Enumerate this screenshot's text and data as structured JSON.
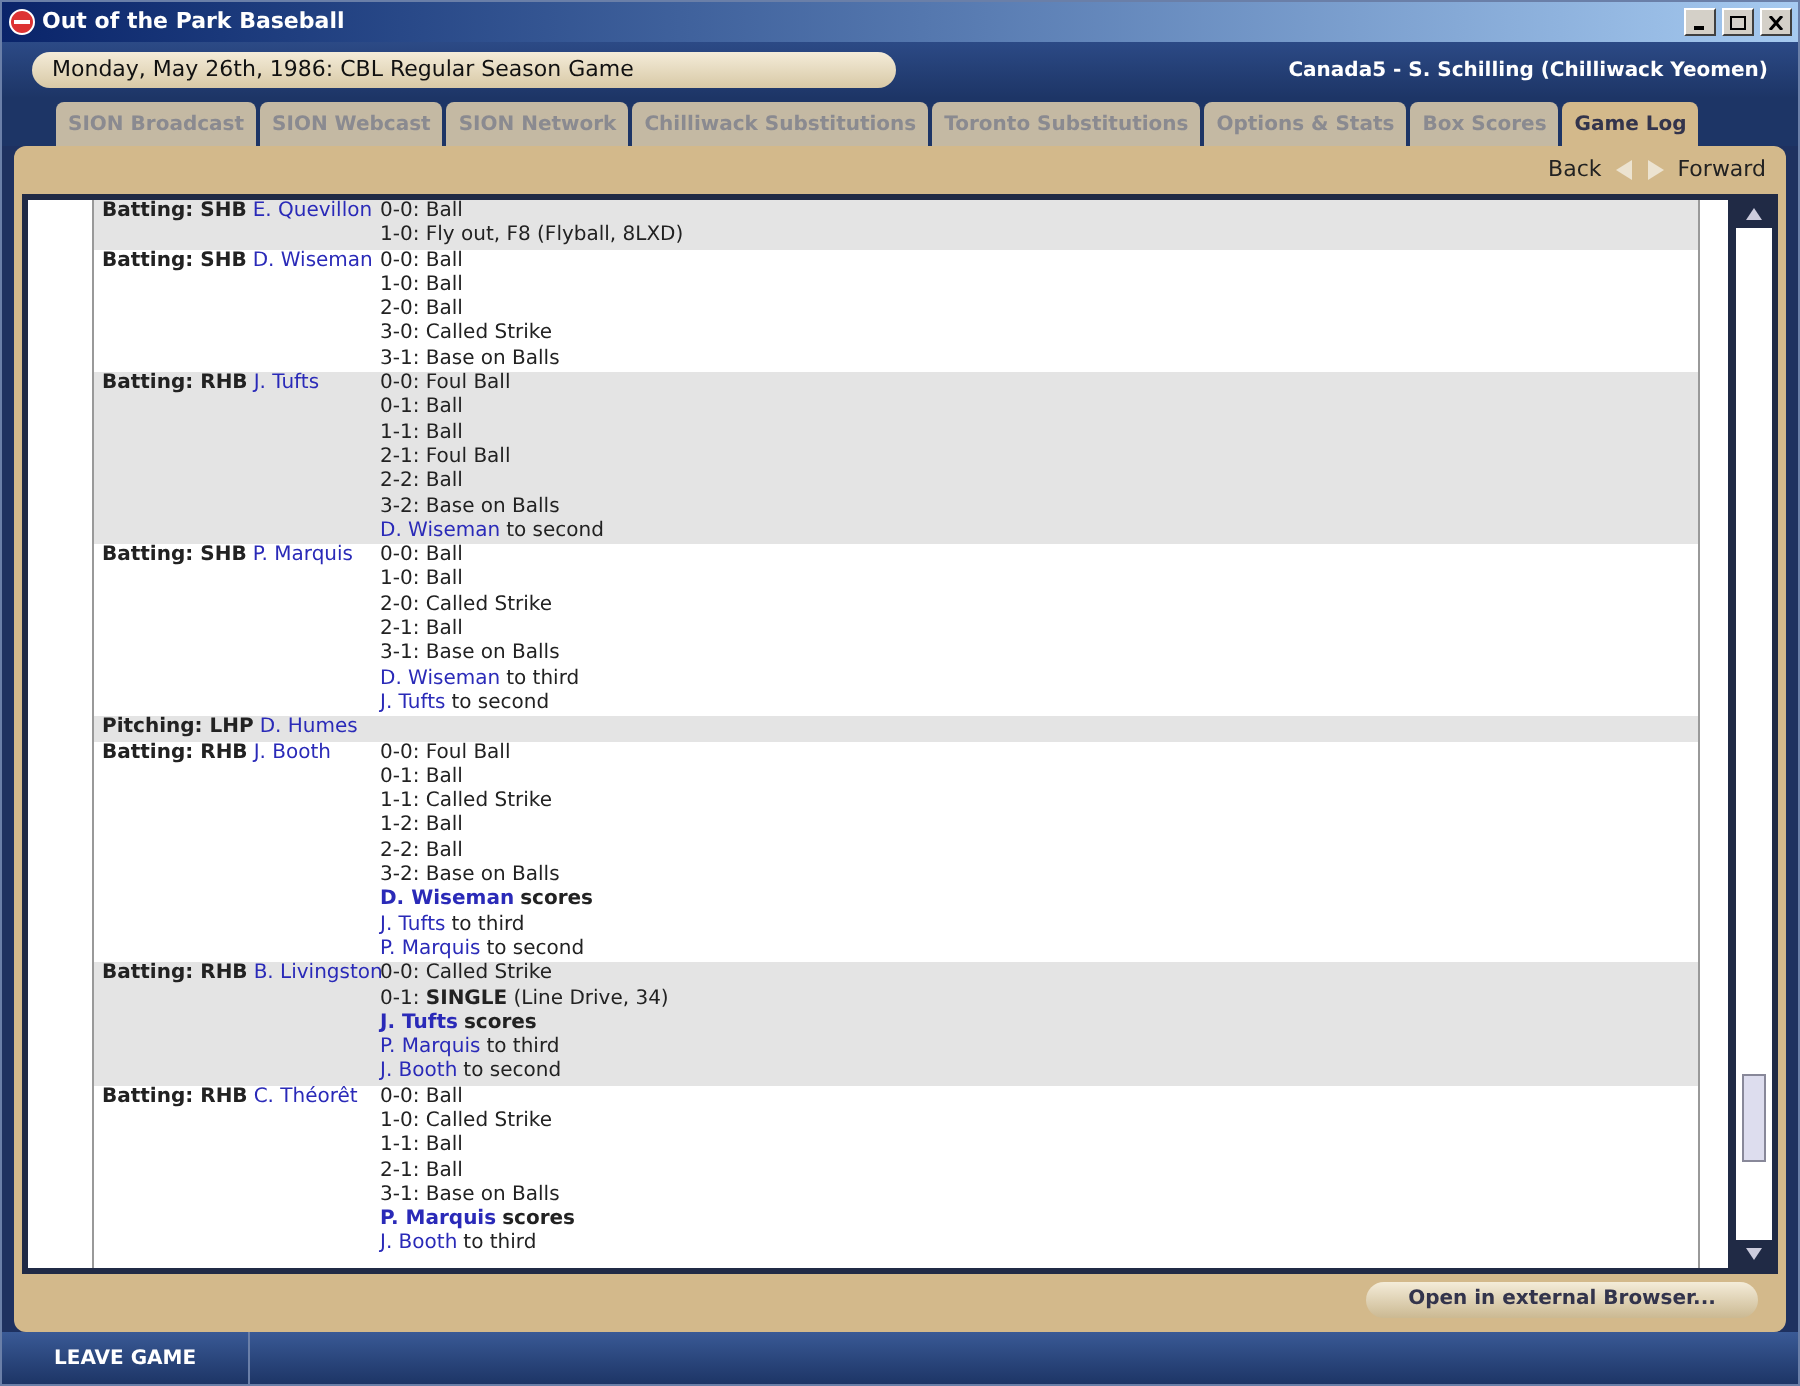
{
  "window": {
    "title": "Out of the Park Baseball"
  },
  "header": {
    "date": "Monday, May 26th, 1986: CBL Regular Season Game",
    "user": "Canada5 - S. Schilling (Chilliwack Yeomen)"
  },
  "tabs": [
    {
      "label": "SION Broadcast",
      "selected": false
    },
    {
      "label": "SION Webcast",
      "selected": false
    },
    {
      "label": "SION Network",
      "selected": false
    },
    {
      "label": "Chilliwack Substitutions",
      "selected": false
    },
    {
      "label": "Toronto Substitutions",
      "selected": false
    },
    {
      "label": "Options & Stats",
      "selected": false
    },
    {
      "label": "Box Scores",
      "selected": false
    },
    {
      "label": "Game Log",
      "selected": true
    }
  ],
  "nav": {
    "back": "Back",
    "forward": "Forward"
  },
  "log": [
    {
      "kind": "batting",
      "role": "Batting: SHB",
      "player": "E. Quevillon",
      "lines": [
        {
          "kind": "pitch",
          "text": "0-0: Ball"
        },
        {
          "kind": "pitch",
          "text": "1-0: Fly out, F8 (Flyball, 8LXD)"
        }
      ]
    },
    {
      "kind": "batting",
      "role": "Batting: SHB",
      "player": "D. Wiseman",
      "lines": [
        {
          "kind": "pitch",
          "text": "0-0: Ball"
        },
        {
          "kind": "pitch",
          "text": "1-0: Ball"
        },
        {
          "kind": "pitch",
          "text": "2-0: Ball"
        },
        {
          "kind": "pitch",
          "text": "3-0: Called Strike"
        },
        {
          "kind": "pitch",
          "text": "3-1: Base on Balls"
        }
      ]
    },
    {
      "kind": "batting",
      "role": "Batting: RHB",
      "player": "J. Tufts",
      "lines": [
        {
          "kind": "pitch",
          "text": "0-0: Foul Ball"
        },
        {
          "kind": "pitch",
          "text": "0-1: Ball"
        },
        {
          "kind": "pitch",
          "text": "1-1: Ball"
        },
        {
          "kind": "pitch",
          "text": "2-1: Foul Ball"
        },
        {
          "kind": "pitch",
          "text": "2-2: Ball"
        },
        {
          "kind": "pitch",
          "text": "3-2: Base on Balls"
        },
        {
          "kind": "runner",
          "player": "D. Wiseman",
          "text": "to second",
          "scores": false
        }
      ]
    },
    {
      "kind": "batting",
      "role": "Batting: SHB",
      "player": "P. Marquis",
      "lines": [
        {
          "kind": "pitch",
          "text": "0-0: Ball"
        },
        {
          "kind": "pitch",
          "text": "1-0: Ball"
        },
        {
          "kind": "pitch",
          "text": "2-0: Called Strike"
        },
        {
          "kind": "pitch",
          "text": "2-1: Ball"
        },
        {
          "kind": "pitch",
          "text": "3-1: Base on Balls"
        },
        {
          "kind": "runner",
          "player": "D. Wiseman",
          "text": "to third",
          "scores": false
        },
        {
          "kind": "runner",
          "player": "J. Tufts",
          "text": "to second",
          "scores": false
        }
      ]
    },
    {
      "kind": "pitching",
      "role": "Pitching: LHP",
      "player": "D. Humes"
    },
    {
      "kind": "batting",
      "role": "Batting: RHB",
      "player": "J. Booth",
      "lines": [
        {
          "kind": "pitch",
          "text": "0-0: Foul Ball"
        },
        {
          "kind": "pitch",
          "text": "0-1: Ball"
        },
        {
          "kind": "pitch",
          "text": "1-1: Called Strike"
        },
        {
          "kind": "pitch",
          "text": "1-2: Ball"
        },
        {
          "kind": "pitch",
          "text": "2-2: Ball"
        },
        {
          "kind": "pitch",
          "text": "3-2: Base on Balls"
        },
        {
          "kind": "runner",
          "player": "D. Wiseman",
          "text": "scores",
          "scores": true
        },
        {
          "kind": "runner",
          "player": "J. Tufts",
          "text": "to third",
          "scores": false
        },
        {
          "kind": "runner",
          "player": "P. Marquis",
          "text": "to second",
          "scores": false
        }
      ]
    },
    {
      "kind": "batting",
      "role": "Batting: RHB",
      "player": "B. Livingston",
      "lines": [
        {
          "kind": "pitch",
          "text": "0-0: Called Strike"
        },
        {
          "kind": "pitch",
          "text": "0-1: **SINGLE** (Line Drive, 34)"
        },
        {
          "kind": "runner",
          "player": "J. Tufts",
          "text": "scores",
          "scores": true
        },
        {
          "kind": "runner",
          "player": "P. Marquis",
          "text": "to third",
          "scores": false
        },
        {
          "kind": "runner",
          "player": "J. Booth",
          "text": "to second",
          "scores": false
        }
      ]
    },
    {
      "kind": "batting",
      "role": "Batting: RHB",
      "player": "C. Théorêt",
      "lines": [
        {
          "kind": "pitch",
          "text": "0-0: Ball"
        },
        {
          "kind": "pitch",
          "text": "1-0: Called Strike"
        },
        {
          "kind": "pitch",
          "text": "1-1: Ball"
        },
        {
          "kind": "pitch",
          "text": "2-1: Ball"
        },
        {
          "kind": "pitch",
          "text": "3-1: Base on Balls"
        },
        {
          "kind": "runner",
          "player": "P. Marquis",
          "text": "scores",
          "scores": true
        },
        {
          "kind": "runner",
          "player": "J. Booth",
          "text": "to third",
          "scores": false
        }
      ]
    }
  ],
  "open_button": "Open in external Browser...",
  "leave_button": "LEAVE GAME"
}
